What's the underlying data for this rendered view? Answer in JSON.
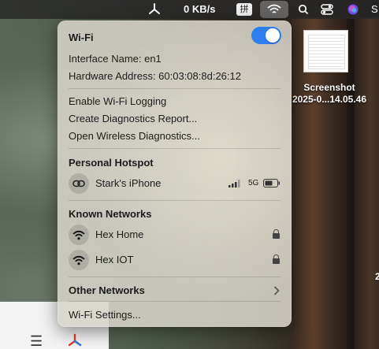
{
  "menubar": {
    "netspeed": "0 KB/s",
    "input_badge": "拼",
    "right_text": "S"
  },
  "wifi_menu": {
    "title": "Wi-Fi",
    "toggle_on": true,
    "interface_label": "Interface Name: en1",
    "hardware_label": "Hardware Address: 60:03:08:8d:26:12",
    "actions": [
      "Enable Wi-Fi Logging",
      "Create Diagnostics Report...",
      "Open Wireless Diagnostics..."
    ],
    "hotspot": {
      "header": "Personal Hotspot",
      "device": "Stark's iPhone",
      "network_type": "5G"
    },
    "known": {
      "header": "Known Networks",
      "networks": [
        {
          "name": "Hex Home",
          "locked": true
        },
        {
          "name": "Hex IOT",
          "locked": true
        }
      ]
    },
    "other_networks": "Other Networks",
    "settings": "Wi-Fi Settings..."
  },
  "desktop": {
    "file_name_line1": "Screenshot",
    "file_name_line2": "2025-0...14.05.46"
  },
  "colors": {
    "toggle_on": "#2f7ef0",
    "panel_bg": "#d7d4c8"
  }
}
